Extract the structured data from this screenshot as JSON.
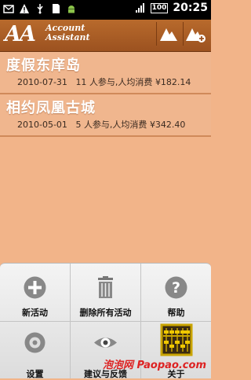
{
  "status": {
    "battery": "100",
    "time": "20:25"
  },
  "app": {
    "logo": "AA",
    "name_line1": "Account",
    "name_line2": "Assistant"
  },
  "activities": [
    {
      "title": "度假东庠岛",
      "date": "2010-07-31",
      "count": "11",
      "participants_label": "人参与,人均消费",
      "amount": "¥182.14"
    },
    {
      "title": "相约凤凰古城",
      "date": "2010-05-01",
      "count": "5",
      "participants_label": "人参与,人均消费",
      "amount": "¥342.40"
    }
  ],
  "menu": {
    "items": [
      {
        "label": "新活动",
        "icon": "add-icon"
      },
      {
        "label": "删除所有活动",
        "icon": "trash-icon"
      },
      {
        "label": "帮助",
        "icon": "help-icon"
      },
      {
        "label": "设置",
        "icon": "settings-icon"
      },
      {
        "label": "建议与反馈",
        "icon": "eye-icon"
      },
      {
        "label": "关于",
        "icon": "abacus-icon"
      }
    ]
  },
  "watermark": "泡泡网 Paopao.com",
  "colors": {
    "background": "#f2b489",
    "header": "#a85a24",
    "row": "#f0b68e"
  }
}
